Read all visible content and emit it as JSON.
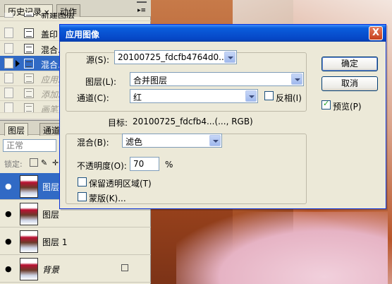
{
  "history_panel": {
    "tabs": [
      {
        "label": "历史记录"
      },
      {
        "label": "动作"
      }
    ],
    "items": [
      {
        "label": "新建图层"
      },
      {
        "label": "盖印"
      },
      {
        "label": "混合..."
      },
      {
        "label": "混合..."
      },
      {
        "label": "应用..."
      },
      {
        "label": "添加..."
      },
      {
        "label": "画笔"
      }
    ]
  },
  "layers_panel": {
    "tabs": [
      {
        "label": "图层"
      },
      {
        "label": "通道"
      }
    ],
    "blend_mode": "正常",
    "lock_label": "锁定:",
    "layers": [
      {
        "name": "图层"
      },
      {
        "name": "图层"
      },
      {
        "name": "图层 1"
      },
      {
        "name": "背景"
      }
    ]
  },
  "dialog": {
    "title": "应用图像",
    "source_label": "源(S):",
    "source_value": "20100725_fdcfb4764d0...",
    "layer_label": "图层(L):",
    "layer_value": "合并图层",
    "channel_label": "通道(C):",
    "channel_value": "红",
    "invert_label": "反相(I)",
    "target_label": "目标:",
    "target_value": "20100725_fdcfb4...(..., RGB)",
    "blend_label": "混合(B):",
    "blend_value": "滤色",
    "opacity_label": "不透明度(O):",
    "opacity_value": "70",
    "opacity_unit": "%",
    "preserve_label": "保留透明区域(T)",
    "mask_label": "蒙版(K)...",
    "ok_label": "确定",
    "cancel_label": "取消",
    "preview_label": "预览(P)",
    "preview_checked": true,
    "close_glyph": "X"
  }
}
